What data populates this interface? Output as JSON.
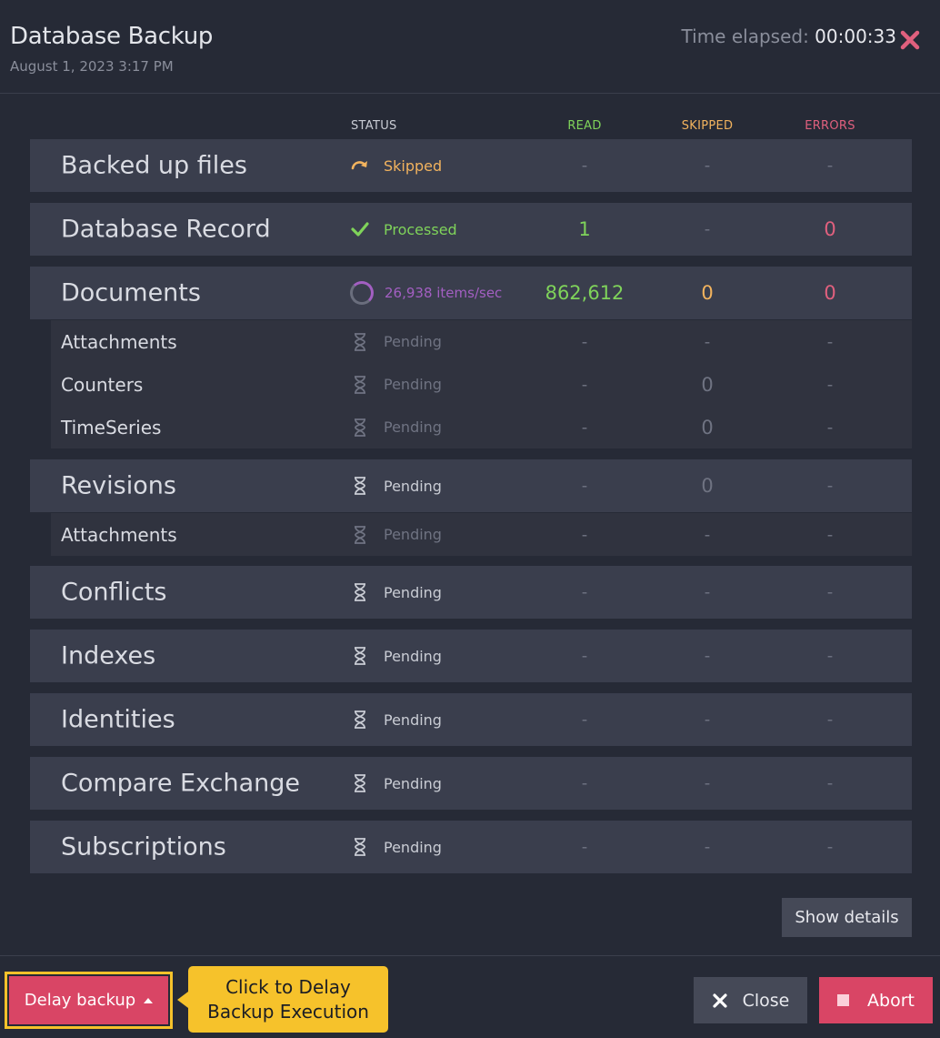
{
  "header": {
    "title": "Database Backup",
    "date": "August 1, 2023 3:17 PM",
    "elapsed_label": "Time elapsed:",
    "elapsed_value": "00:00:33"
  },
  "columns": {
    "status": "STATUS",
    "read": "READ",
    "skipped": "SKIPPED",
    "errors": "ERRORS"
  },
  "rows": [
    {
      "name": "Backed up files",
      "status": "Skipped",
      "read": "-",
      "skipped": "-",
      "errors": "-"
    },
    {
      "name": "Database Record",
      "status": "Processed",
      "read": "1",
      "skipped": "-",
      "errors": "0"
    },
    {
      "name": "Documents",
      "status": "26,938 items/sec",
      "read": "862,612",
      "skipped": "0",
      "errors": "0"
    },
    {
      "name": "Attachments",
      "status": "Pending",
      "read": "-",
      "skipped": "-",
      "errors": "-"
    },
    {
      "name": "Counters",
      "status": "Pending",
      "read": "-",
      "skipped": "0",
      "errors": "-"
    },
    {
      "name": "TimeSeries",
      "status": "Pending",
      "read": "-",
      "skipped": "0",
      "errors": "-"
    },
    {
      "name": "Revisions",
      "status": "Pending",
      "read": "-",
      "skipped": "0",
      "errors": "-"
    },
    {
      "name": "Attachments",
      "status": "Pending",
      "read": "-",
      "skipped": "-",
      "errors": "-"
    },
    {
      "name": "Conflicts",
      "status": "Pending",
      "read": "-",
      "skipped": "-",
      "errors": "-"
    },
    {
      "name": "Indexes",
      "status": "Pending",
      "read": "-",
      "skipped": "-",
      "errors": "-"
    },
    {
      "name": "Identities",
      "status": "Pending",
      "read": "-",
      "skipped": "-",
      "errors": "-"
    },
    {
      "name": "Compare Exchange",
      "status": "Pending",
      "read": "-",
      "skipped": "-",
      "errors": "-"
    },
    {
      "name": "Subscriptions",
      "status": "Pending",
      "read": "-",
      "skipped": "-",
      "errors": "-"
    }
  ],
  "icons": {
    "skipped": "redo-arrow-icon",
    "processed": "check-icon",
    "running": "spinner-icon",
    "pending": "hourglass-icon"
  },
  "colors": {
    "read": "#7fd35a",
    "skipped": "#f2b35e",
    "errors": "#e0607e",
    "running": "#a35fc2",
    "accent": "#d94565",
    "callout": "#f6c22b"
  },
  "footer": {
    "show_details": "Show details",
    "delay_backup": "Delay backup",
    "callout_line1": "Click to Delay",
    "callout_line2": "Backup Execution",
    "close": "Close",
    "abort": "Abort"
  }
}
